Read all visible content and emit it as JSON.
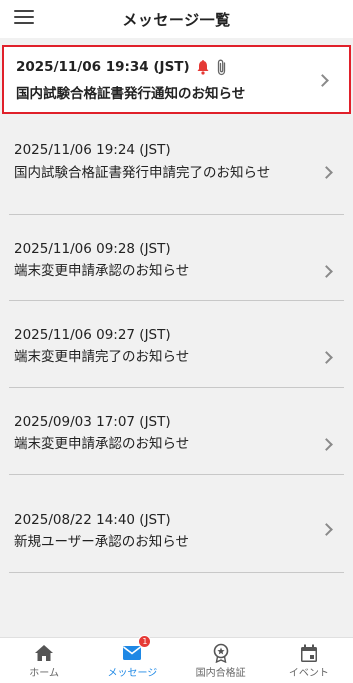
{
  "header": {
    "title": "メッセージ一覧"
  },
  "messages": [
    {
      "date": "2025/11/06 19:34 (JST)",
      "subject": "国内試験合格証書発行通知のお知らせ",
      "unread": true,
      "has_attachment": true
    },
    {
      "date": "2025/11/06 19:24 (JST)",
      "subject": "国内試験合格証書発行申請完了のお知らせ",
      "unread": false,
      "has_attachment": false
    },
    {
      "date": "2025/11/06 09:28 (JST)",
      "subject": "端末変更申請承認のお知らせ",
      "unread": false,
      "has_attachment": false
    },
    {
      "date": "2025/11/06 09:27 (JST)",
      "subject": "端末変更申請完了のお知らせ",
      "unread": false,
      "has_attachment": false
    },
    {
      "date": "2025/09/03 17:07 (JST)",
      "subject": "端末変更申請承認のお知らせ",
      "unread": false,
      "has_attachment": false
    },
    {
      "date": "2025/08/22 14:40 (JST)",
      "subject": "新規ユーザー承認のお知らせ",
      "unread": false,
      "has_attachment": false
    }
  ],
  "nav": [
    {
      "label": "ホーム",
      "icon": "home-icon"
    },
    {
      "label": "メッセージ",
      "icon": "mail-icon",
      "badge": "1",
      "active": true
    },
    {
      "label": "国内合格証",
      "icon": "award-icon"
    },
    {
      "label": "イベント",
      "icon": "calendar-icon"
    }
  ],
  "colors": {
    "accent": "#1e88e5",
    "highlight_border": "#e0202a",
    "bell": "#e53935",
    "background": "#f1f1f1"
  }
}
